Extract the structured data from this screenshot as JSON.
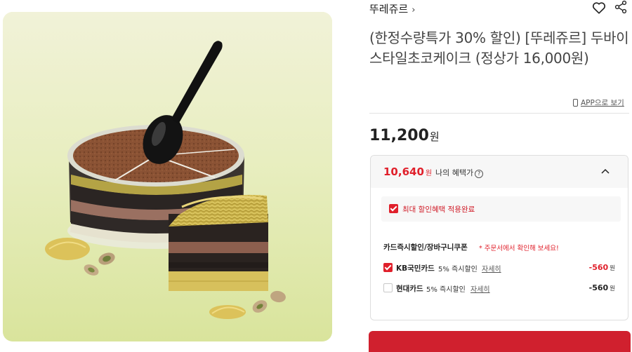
{
  "product": {
    "brand": "뚜레쥬르",
    "brand_chevron": "›",
    "title": "(한정수량특가 30% 할인) [뚜레쥬르] 두바이스타일초코케이크 (정상가 16,000원)",
    "app_view_label": "APP으로 보기",
    "price": "11,200",
    "price_unit": "원"
  },
  "benefit": {
    "price": "10,640",
    "price_unit": "원",
    "label": "나의 혜택가",
    "info_icon": "?",
    "max_label": "최대 할인혜택 적용완료",
    "coupon_heading": "카드즉시할인/장바구니쿠폰",
    "coupon_note": "* 주문서에서 확인해 보세요!",
    "discounts": [
      {
        "name": "KB국민카드",
        "desc": "5% 즉시할인",
        "detail": "자세히",
        "amount": "-560",
        "unit": "원",
        "checked": true,
        "amount_color": "#e0202b"
      },
      {
        "name": "현대카드",
        "desc": "5% 즉시할인",
        "detail": "자세히",
        "amount": "-560",
        "unit": "원",
        "checked": false,
        "amount_color": "#222222"
      }
    ]
  },
  "icons": {
    "favorite": "heart-icon",
    "share": "share-icon",
    "collapse": "chevron-up-icon",
    "app": "mobile-phone-icon"
  },
  "colors": {
    "accent": "#e0202b",
    "buy_button": "#d0202e",
    "image_background": "#eef0cf"
  }
}
